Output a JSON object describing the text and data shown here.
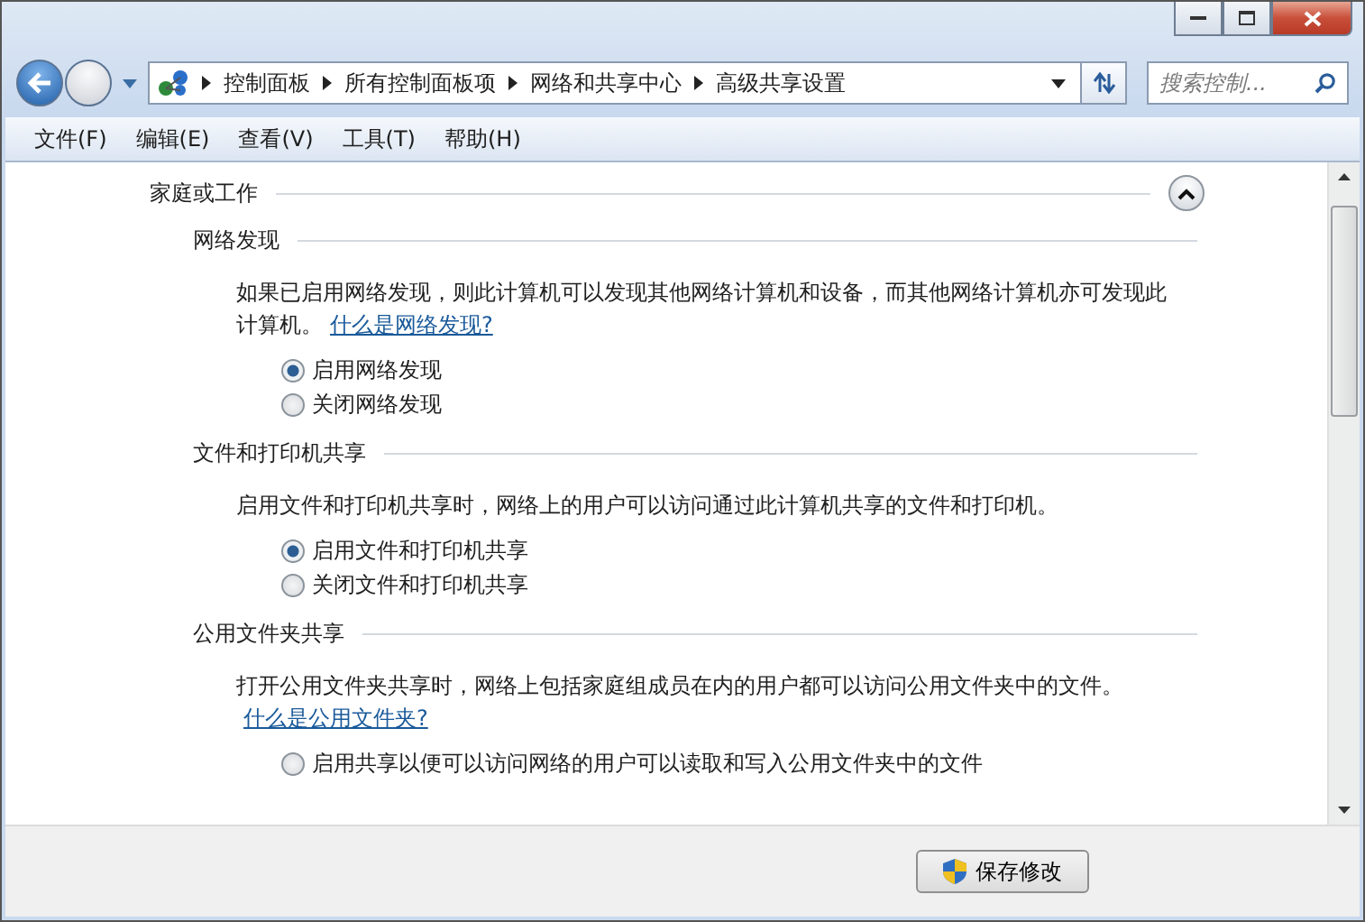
{
  "address_bar": {
    "breadcrumbs": [
      "控制面板",
      "所有控制面板项",
      "网络和共享中心",
      "高级共享设置"
    ]
  },
  "search": {
    "placeholder": "搜索控制..."
  },
  "menu": [
    "文件(F)",
    "编辑(E)",
    "查看(V)",
    "工具(T)",
    "帮助(H)"
  ],
  "profile": {
    "title": "家庭或工作",
    "expanded": true
  },
  "sections": [
    {
      "title": "网络发现",
      "description": "如果已启用网络发现，则此计算机可以发现其他网络计算机和设备，而其他网络计算机亦可发现此计算机。",
      "link": "什么是网络发现?",
      "options": [
        {
          "label": "启用网络发现",
          "selected": true
        },
        {
          "label": "关闭网络发现",
          "selected": false
        }
      ]
    },
    {
      "title": "文件和打印机共享",
      "description": "启用文件和打印机共享时，网络上的用户可以访问通过此计算机共享的文件和打印机。",
      "options": [
        {
          "label": "启用文件和打印机共享",
          "selected": true
        },
        {
          "label": "关闭文件和打印机共享",
          "selected": false
        }
      ]
    },
    {
      "title": "公用文件夹共享",
      "description": "打开公用文件夹共享时，网络上包括家庭组成员在内的用户都可以访问公用文件夹中的文件。",
      "link": "什么是公用文件夹?",
      "options": [
        {
          "label": "启用共享以便可以访问网络的用户可以读取和写入公用文件夹中的文件",
          "selected": false
        }
      ]
    }
  ],
  "buttons": [
    "保存修改"
  ]
}
